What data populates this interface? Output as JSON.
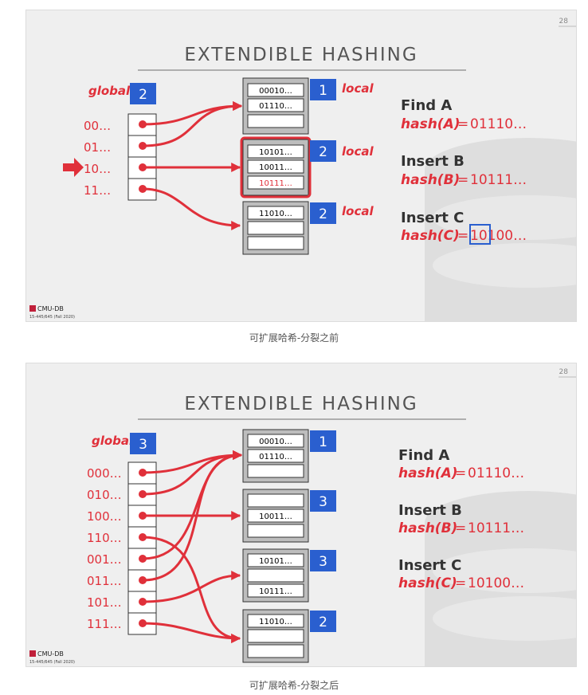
{
  "slides": [
    {
      "page_number": "28",
      "title": "EXTENDIBLE HASHING",
      "global_label": "global",
      "global_depth": "2",
      "directory": [
        "00…",
        "01…",
        "10…",
        "11…"
      ],
      "buckets": [
        {
          "depth": "1",
          "local_label": "local",
          "entries": [
            "00010…",
            "01110…",
            ""
          ]
        },
        {
          "depth": "2",
          "local_label": "local",
          "entries": [
            "10101…",
            "10011…",
            "10111…"
          ]
        },
        {
          "depth": "2",
          "local_label": "local",
          "entries": [
            "11010…",
            "",
            ""
          ]
        }
      ],
      "ops": [
        {
          "title": "Find A",
          "hash": "hash(A)",
          "eq": "=",
          "value": "01110…"
        },
        {
          "title": "Insert B",
          "hash": "hash(B)",
          "eq": "=",
          "value": "10111…"
        },
        {
          "title": "Insert C",
          "hash": "hash(C)",
          "eq": "=",
          "value": "10100…"
        }
      ],
      "logo": "CMU-DB",
      "course": "15-445/645 (Fall 2020)",
      "highlight_color": "#e0303a",
      "depth_box_color": "#2a5fcf"
    },
    {
      "page_number": "28",
      "title": "EXTENDIBLE HASHING",
      "global_label": "global",
      "global_depth": "3",
      "directory": [
        "000…",
        "010…",
        "100…",
        "110…",
        "001…",
        "011…",
        "101…",
        "111…"
      ],
      "buckets": [
        {
          "depth": "1",
          "entries": [
            "00010…",
            "01110…",
            ""
          ]
        },
        {
          "depth": "3",
          "entries": [
            "",
            "10011…",
            ""
          ]
        },
        {
          "depth": "3",
          "entries": [
            "10101…",
            "",
            "10111…"
          ]
        },
        {
          "depth": "2",
          "entries": [
            "11010…",
            "",
            ""
          ]
        }
      ],
      "ops": [
        {
          "title": "Find A",
          "hash": "hash(A)",
          "eq": "=",
          "value": "01110…"
        },
        {
          "title": "Insert B",
          "hash": "hash(B)",
          "eq": "=",
          "value": "10111…"
        },
        {
          "title": "Insert C",
          "hash": "hash(C)",
          "eq": "=",
          "value": "10100…"
        }
      ],
      "logo": "CMU-DB",
      "course": "15-445/645 (Fall 2020)"
    }
  ],
  "captions": [
    "可扩展哈希-分裂之前",
    "可扩展哈希-分裂之后"
  ]
}
